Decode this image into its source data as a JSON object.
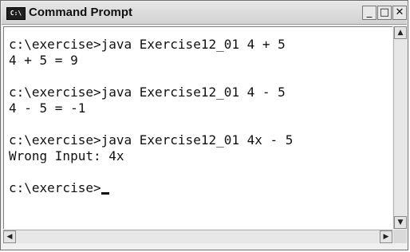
{
  "window": {
    "title": "Command Prompt",
    "icon_label": "C:\\",
    "controls": {
      "minimize_icon": "minimize-icon",
      "maximize_icon": "maximize-icon",
      "close_icon": "close-icon"
    }
  },
  "console": {
    "lines": [
      "c:\\exercise>java Exercise12_01 4 + 5",
      "4 + 5 = 9",
      "",
      "c:\\exercise>java Exercise12_01 4 - 5",
      "4 - 5 = -1",
      "",
      "c:\\exercise>java Exercise12_01 4x - 5",
      "Wrong Input: 4x",
      "",
      "c:\\exercise>"
    ]
  },
  "colors": {
    "console_background": "#ffffff",
    "console_text": "#111111",
    "titlebar": "#dcdcdc"
  }
}
